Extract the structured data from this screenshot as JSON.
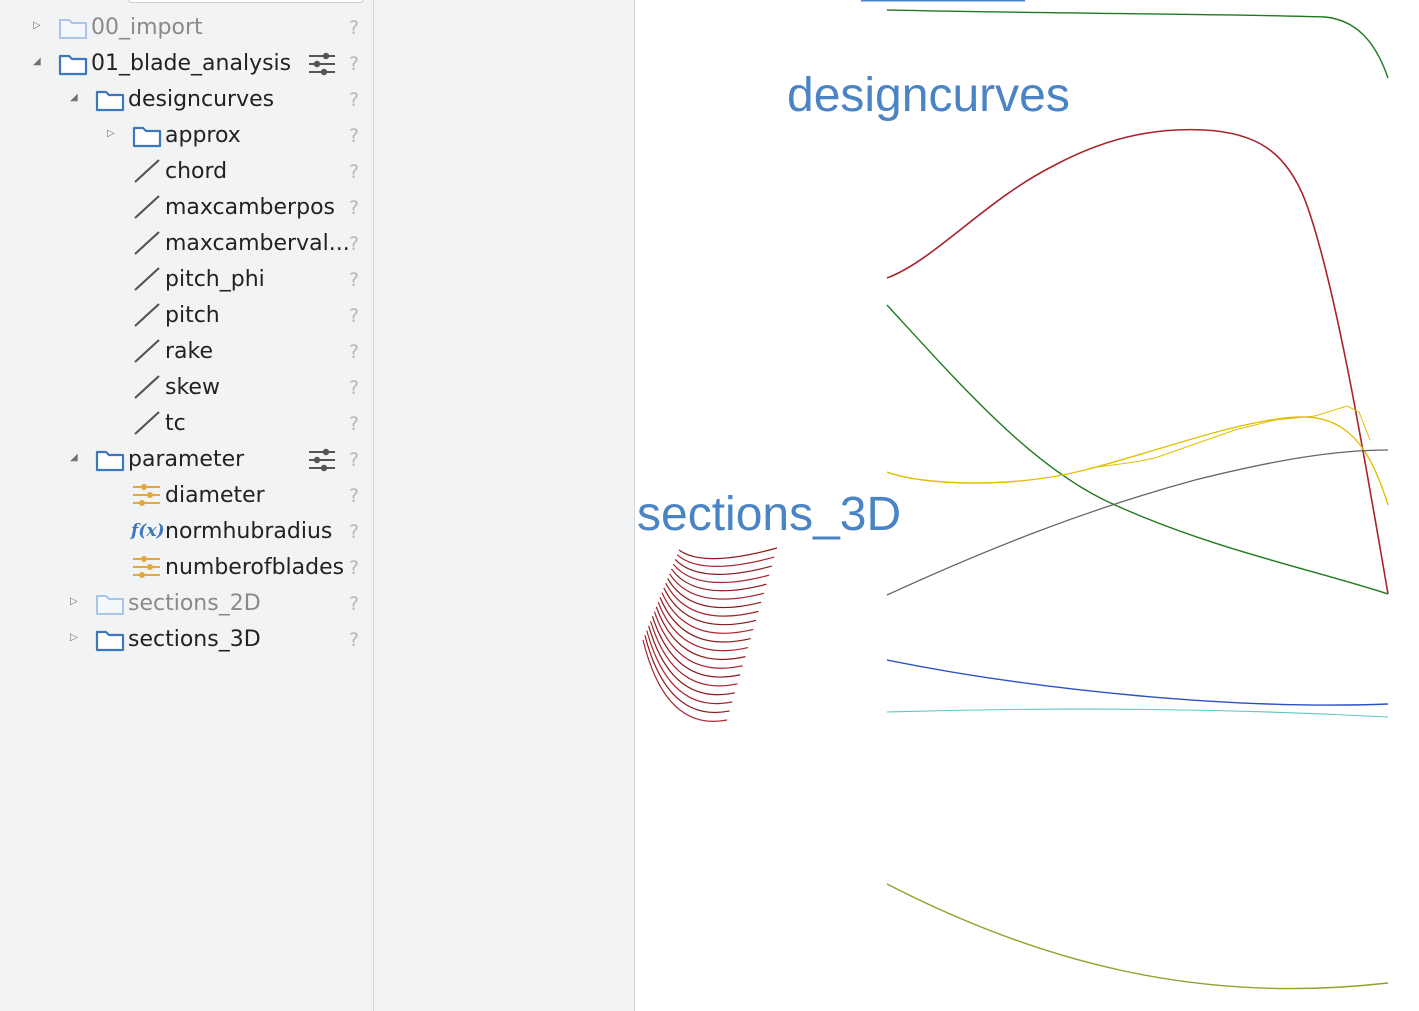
{
  "tree": {
    "import_label": "00_import",
    "blade_analysis_label": "01_blade_analysis",
    "designcurves_label": "designcurves",
    "approx_label": "approx",
    "curves": [
      "chord",
      "maxcamberpos",
      "maxcamberval...",
      "pitch_phi",
      "pitch",
      "rake",
      "skew",
      "tc"
    ],
    "parameter_label": "parameter",
    "diameter_label": "diameter",
    "normhubradius_label": "normhubradius",
    "numberofblades_label": "numberofblades",
    "sections2d_label": "sections_2D",
    "sections3d_label": "sections_3D",
    "help_glyph": "?",
    "function_glyph": "f(x)"
  },
  "viewport": {
    "designcurves_label": "designcurves",
    "sections3d_label": "sections_3D"
  },
  "colors": {
    "folder": "#3f77bd",
    "folder_dim": "#a9c6ea",
    "parameter_icon": "#e2a93a",
    "viewport_label": "#4a84c4",
    "curve_red": "#a8232c",
    "curve_green": "#1e7a1e",
    "curve_yellow": "#e0c000",
    "curve_gray": "#666666",
    "curve_blue": "#2a4fc8",
    "curve_cyan": "#5fc7c0",
    "curve_olive": "#8aa52a"
  }
}
